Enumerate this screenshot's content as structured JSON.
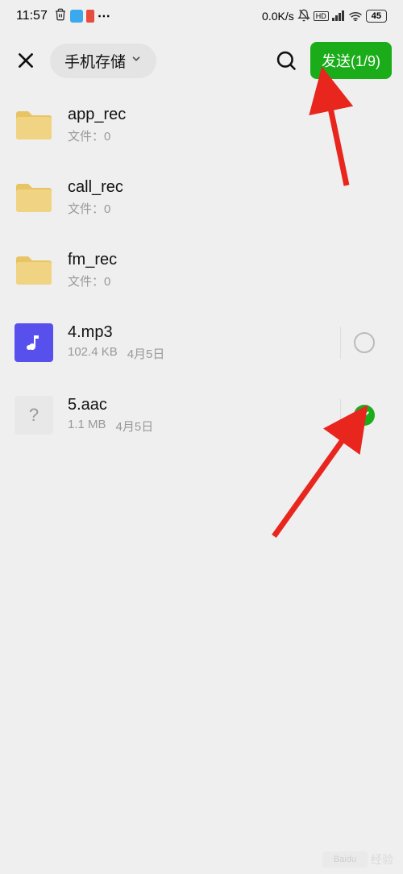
{
  "statusbar": {
    "time": "11:57",
    "net_speed": "0.0K/s",
    "battery": "45"
  },
  "toolbar": {
    "storage_label": "手机存储",
    "send_label": "发送(1/9)"
  },
  "files": [
    {
      "name": "app_rec",
      "meta1": "文件：0",
      "meta2": "",
      "type": "folder",
      "selectable": false
    },
    {
      "name": "call_rec",
      "meta1": "文件：0",
      "meta2": "",
      "type": "folder",
      "selectable": false
    },
    {
      "name": "fm_rec",
      "meta1": "文件：0",
      "meta2": "",
      "type": "folder",
      "selectable": false
    },
    {
      "name": "4.mp3",
      "meta1": "102.4 KB",
      "meta2": "4月5日",
      "type": "audio",
      "selectable": true,
      "selected": false
    },
    {
      "name": "5.aac",
      "meta1": "1.1 MB",
      "meta2": "4月5日",
      "type": "unknown",
      "selectable": true,
      "selected": true
    }
  ],
  "watermark": {
    "brand": "Baidu",
    "text": "经验"
  }
}
